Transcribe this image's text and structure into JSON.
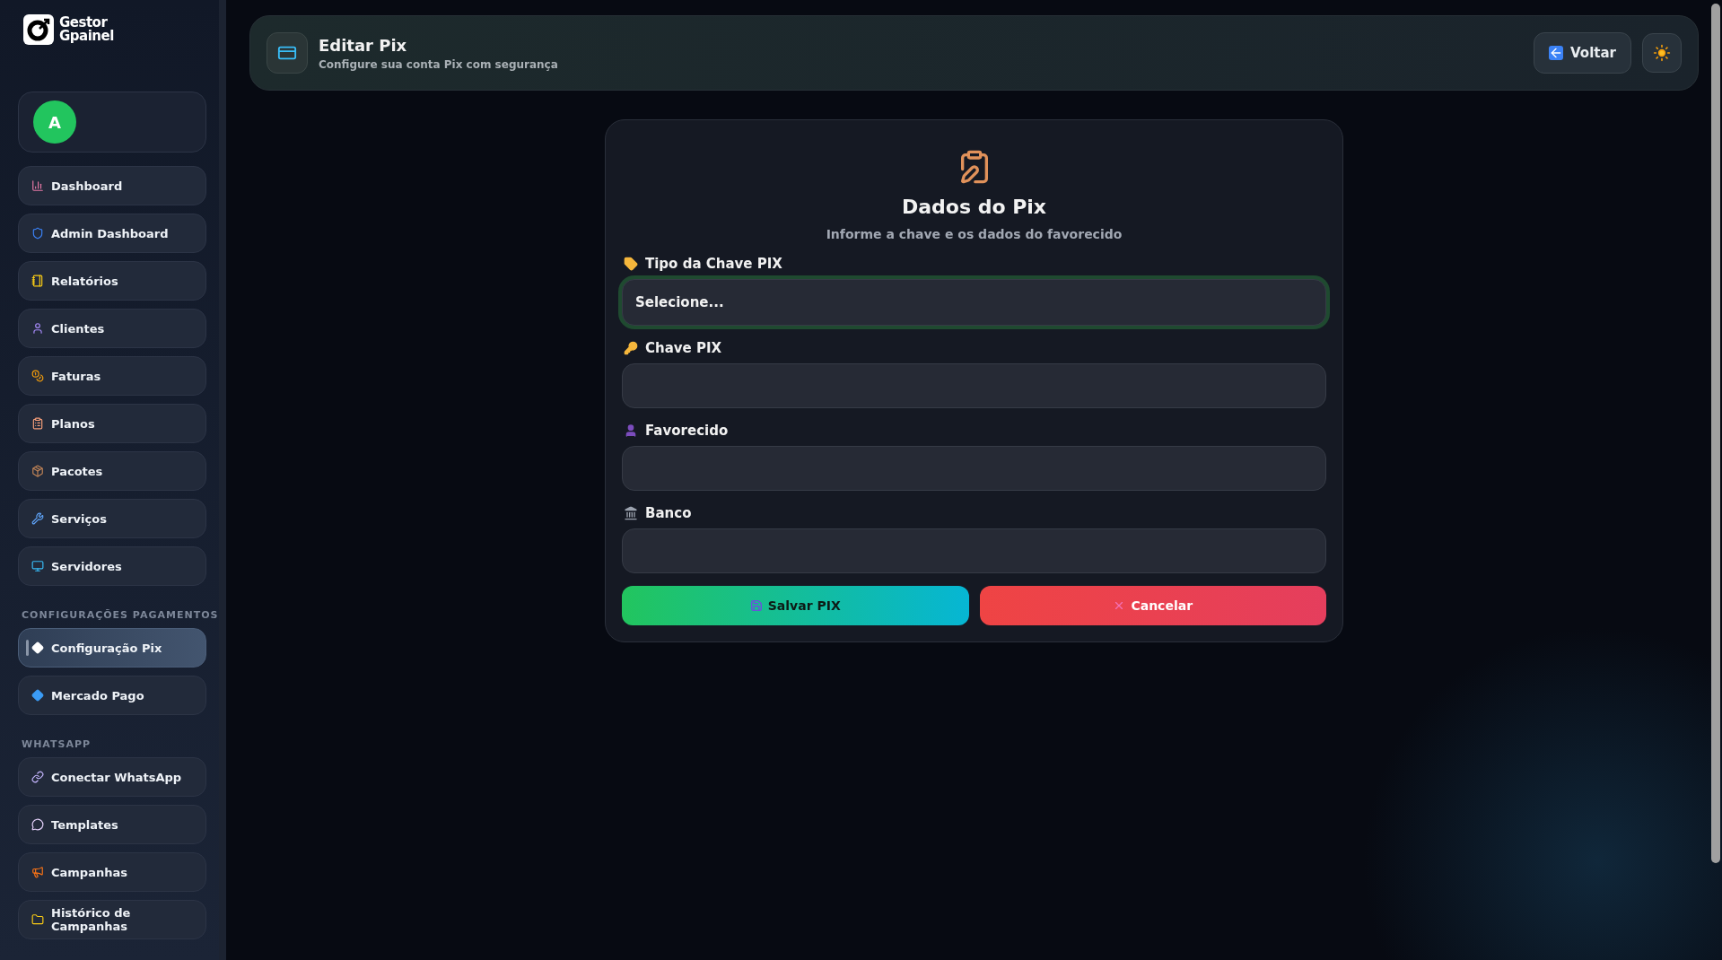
{
  "sidebar": {
    "logo": {
      "line1": "Gestor",
      "line2": "Gpainel"
    },
    "user": {
      "initial": "A"
    },
    "sections": [
      {
        "items": [
          {
            "label": "Dashboard",
            "selected": false
          },
          {
            "label": "Admin Dashboard",
            "selected": false
          },
          {
            "label": "Relatórios",
            "selected": false
          },
          {
            "label": "Clientes",
            "selected": false
          },
          {
            "label": "Faturas",
            "selected": false
          },
          {
            "label": "Planos",
            "selected": false
          },
          {
            "label": "Pacotes",
            "selected": false
          },
          {
            "label": "Serviços",
            "selected": false
          },
          {
            "label": "Servidores",
            "selected": false
          }
        ]
      },
      {
        "heading": "CONFIGURAÇÕES PAGAMENTOS",
        "items": [
          {
            "label": "Configuração Pix",
            "selected": true
          },
          {
            "label": "Mercado Pago",
            "selected": false
          }
        ]
      },
      {
        "heading": "WHATSAPP",
        "items": [
          {
            "label": "Conectar WhatsApp",
            "selected": false
          },
          {
            "label": "Templates",
            "selected": false
          },
          {
            "label": "Campanhas",
            "selected": false
          },
          {
            "label": "Histórico de Campanhas",
            "selected": false
          }
        ]
      }
    ]
  },
  "header": {
    "title": "Editar Pix",
    "subtitle": "Configure sua conta Pix com segurança",
    "back_button": "Voltar"
  },
  "card": {
    "title": "Dados do Pix",
    "subtitle": "Informe a chave e os dados do favorecido",
    "fields": [
      {
        "kind": "select",
        "label": "Tipo da Chave PIX",
        "value": "Selecione...",
        "focused": true
      },
      {
        "kind": "input",
        "label": "Chave PIX",
        "focused": false
      },
      {
        "kind": "input",
        "label": "Favorecido",
        "focused": false
      },
      {
        "kind": "input",
        "label": "Banco",
        "focused": false
      }
    ],
    "buttons": [
      {
        "kind": "save",
        "label": "Salvar PIX"
      },
      {
        "kind": "cancel",
        "label": "Cancelar"
      }
    ]
  }
}
